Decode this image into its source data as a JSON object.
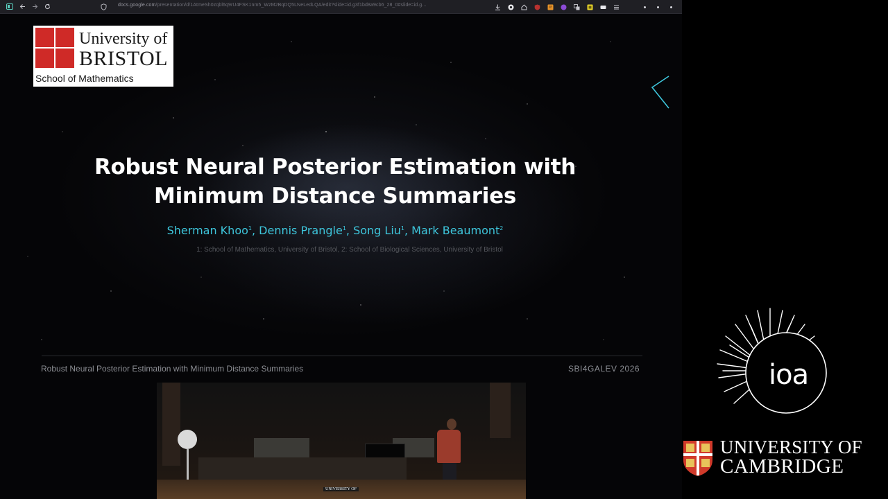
{
  "browser": {
    "url_host": "docs.google.com",
    "url_path": "/presentation/d/1AtmeSh0zqbl6q9rU4FSK1nm5_WzM2BqDQ5LNeLedLQA/edit?slide=id.g3f1bd8a9cb6_28_0#slide=id.g..."
  },
  "slide": {
    "logo": {
      "line1": "University of",
      "line2": "BRISTOL",
      "line3": "School of Mathematics"
    },
    "title_line1": "Robust Neural Posterior Estimation with",
    "title_line2": "Minimum Distance Summaries",
    "authors": [
      {
        "name": "Sherman Khoo",
        "sup": "1"
      },
      {
        "name": "Dennis Prangle",
        "sup": "1"
      },
      {
        "name": "Song Liu",
        "sup": "1"
      },
      {
        "name": "Mark Beaumont",
        "sup": "2"
      }
    ],
    "affiliations": "1: School of Mathematics, University of Bristol, 2: School of Biological Sciences, University of Bristol",
    "footer_left": "Robust Neural Posterior Estimation with Minimum Distance Summaries",
    "footer_right": "SBI4GALEV 2026"
  },
  "webcam": {
    "sign_text": "UNIVERSITY OF"
  },
  "right_panel": {
    "ioa_text": "ioa",
    "cambridge_line1": "UNIVERSITY OF",
    "cambridge_line2": "CAMBRIDGE"
  },
  "colors": {
    "accent_cyan": "#3ec6dc",
    "bristol_red": "#cf2a27",
    "cambridge_red": "#d03a2a"
  }
}
